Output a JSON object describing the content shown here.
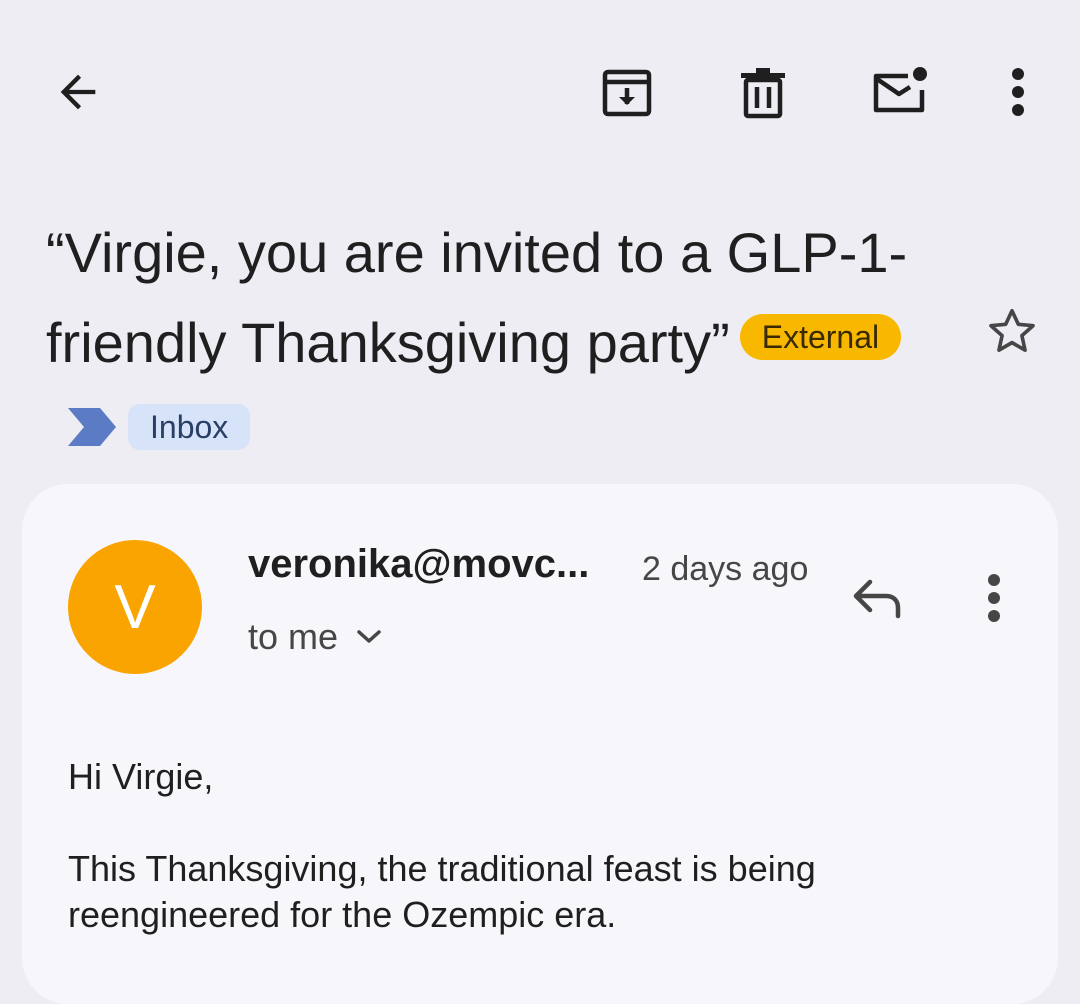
{
  "toolbar": {
    "back_icon": "arrow-back-icon",
    "archive_icon": "archive-icon",
    "delete_icon": "trash-icon",
    "mark_unread_icon": "mark-unread-icon",
    "more_icon": "more-vert-icon"
  },
  "subject": {
    "text": "“Virgie, you are invited to a GLP-1-friendly Thanksgiving party”",
    "labels": {
      "external": "External",
      "inbox": "Inbox"
    },
    "importance_icon": "importance-marker-icon",
    "star_icon": "star-outline-icon"
  },
  "message": {
    "avatar_letter": "V",
    "avatar_color": "#f9a400",
    "sender": "veronika@movc...",
    "time": "2 days ago",
    "recipient": "to me",
    "recipient_icon": "chevron-down-icon",
    "reply_icon": "reply-icon",
    "more_icon": "more-vert-icon",
    "body": {
      "greeting": "Hi Virgie,",
      "paragraph1": "This Thanksgiving, the traditional feast is being reengineered for the Ozempic era."
    }
  },
  "colors": {
    "background": "#eeedf3",
    "card": "#f7f6fb",
    "external_chip": "#f9b800",
    "inbox_chip": "#d7e3f8",
    "importance": "#5b7cc4"
  }
}
